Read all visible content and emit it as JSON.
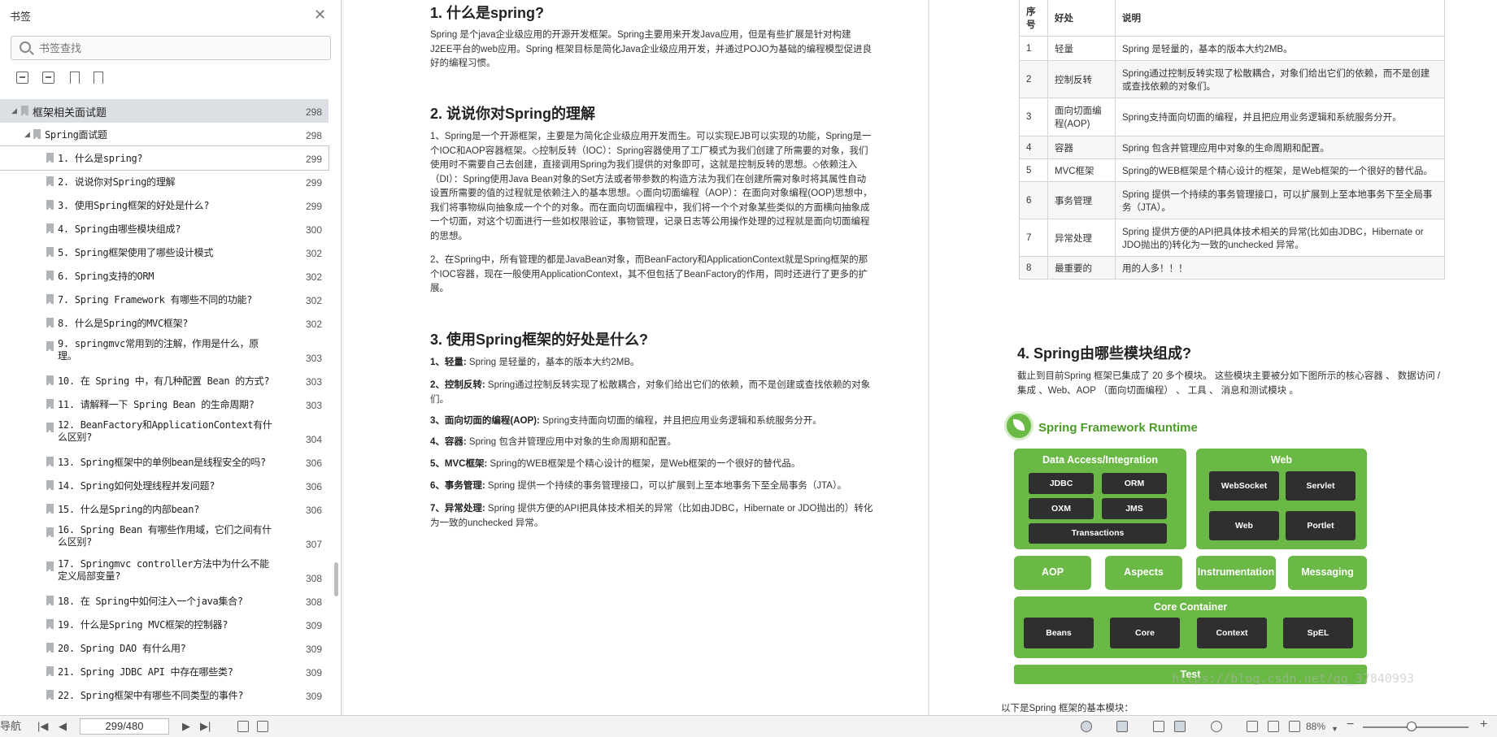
{
  "sidebar": {
    "title": "书签",
    "search_placeholder": "书签查找",
    "items": [
      {
        "label": "框架相关面试题",
        "page": "298"
      },
      {
        "label": "Spring面试题",
        "page": "298"
      },
      {
        "label": "1. 什么是spring?",
        "page": "299"
      },
      {
        "label": "2. 说说你对Spring的理解",
        "page": "299"
      },
      {
        "label": "3. 使用Spring框架的好处是什么?",
        "page": "299"
      },
      {
        "label": "4. Spring由哪些模块组成?",
        "page": "300"
      },
      {
        "label": "5. Spring框架使用了哪些设计模式",
        "page": "302"
      },
      {
        "label": "6. Spring支持的ORM",
        "page": "302"
      },
      {
        "label": "7. Spring Framework 有哪些不同的功能?",
        "page": "302"
      },
      {
        "label": "8. 什么是Spring的MVC框架?",
        "page": "302"
      },
      {
        "label": "9. springmvc常用到的注解，作用是什么，原理。",
        "page": "303"
      },
      {
        "label": "10. 在 Spring 中，有几种配置 Bean 的方式?",
        "page": "303"
      },
      {
        "label": "11. 请解释一下 Spring Bean 的生命周期?",
        "page": "303"
      },
      {
        "label": "12. BeanFactory和ApplicationContext有什么区别?",
        "page": "304"
      },
      {
        "label": "13. Spring框架中的单例bean是线程安全的吗?",
        "page": "306"
      },
      {
        "label": "14. Spring如何处理线程并发问题?",
        "page": "306"
      },
      {
        "label": "15. 什么是Spring的内部bean?",
        "page": "306"
      },
      {
        "label": "16. Spring Bean 有哪些作用域，它们之间有什么区别?",
        "page": "307"
      },
      {
        "label": "17. Springmvc controller方法中为什么不能定义局部变量?",
        "page": "308"
      },
      {
        "label": "18. 在 Spring中如何注入一个java集合?",
        "page": "308"
      },
      {
        "label": "19. 什么是Spring MVC框架的控制器?",
        "page": "309"
      },
      {
        "label": "20. Spring DAO 有什么用?",
        "page": "309"
      },
      {
        "label": "21. Spring JDBC API 中存在哪些类?",
        "page": "309"
      },
      {
        "label": "22. Spring框架中有哪些不同类型的事件?",
        "page": "309"
      }
    ]
  },
  "page1": {
    "s1": {
      "title": "1. 什么是spring?",
      "p1": "Spring 是个java企业级应用的开源开发框架。Spring主要用来开发Java应用，但是有些扩展是针对构建J2EE平台的web应用。Spring 框架目标是简化Java企业级应用开发，并通过POJO为基础的编程模型促进良好的编程习惯。"
    },
    "s2": {
      "title": "2. 说说你对Spring的理解",
      "p1": "1、Spring是一个开源框架，主要是为简化企业级应用开发而生。可以实现EJB可以实现的功能，Spring是一个IOC和AOP容器框架。◇控制反转（IOC）：Spring容器使用了工厂模式为我们创建了所需要的对象，我们使用时不需要自己去创建，直接调用Spring为我们提供的对象即可，这就是控制反转的思想。◇依赖注入（DI）：Spring使用Java Bean对象的Set方法或者带参数的构造方法为我们在创建所需对象时将其属性自动设置所需要的值的过程就是依赖注入的基本思想。◇面向切面编程（AOP）：在面向对象编程(OOP)思想中，我们将事物纵向抽象成一个个的对象。而在面向切面编程中，我们将一个个对象某些类似的方面横向抽象成一个切面，对这个切面进行一些如权限验证，事物管理，记录日志等公用操作处理的过程就是面向切面编程的思想。",
      "p2": "2、在Spring中，所有管理的都是JavaBean对象，而BeanFactory和ApplicationContext就是Spring框架的那个IOC容器，现在一般使用ApplicationContext，其不但包括了BeanFactory的作用，同时还进行了更多的扩展。"
    },
    "s3": {
      "title": "3. 使用Spring框架的好处是什么?",
      "items": [
        {
          "k": "1、轻量:",
          "v": " Spring 是轻量的，基本的版本大约2MB。"
        },
        {
          "k": "2、控制反转:",
          "v": " Spring通过控制反转实现了松散耦合，对象们给出它们的依赖，而不是创建或查找依赖的对象们。"
        },
        {
          "k": "3、面向切面的编程(AOP):",
          "v": " Spring支持面向切面的编程，并且把应用业务逻辑和系统服务分开。"
        },
        {
          "k": "4、容器:",
          "v": " Spring 包含并管理应用中对象的生命周期和配置。"
        },
        {
          "k": "5、MVC框架:",
          "v": " Spring的WEB框架是个精心设计的框架，是Web框架的一个很好的替代品。"
        },
        {
          "k": "6、事务管理:",
          "v": " Spring 提供一个持续的事务管理接口，可以扩展到上至本地事务下至全局事务（JTA）。"
        },
        {
          "k": "7、异常处理:",
          "v": " Spring 提供方便的API把具体技术相关的异常（比如由JDBC，Hibernate or JDO抛出的）转化为一致的unchecked 异常。"
        }
      ]
    }
  },
  "page2": {
    "table": {
      "headers": [
        "序号",
        "好处",
        "说明"
      ],
      "rows": [
        [
          "1",
          "轻量",
          "Spring 是轻量的，基本的版本大约2MB。"
        ],
        [
          "2",
          "控制反转",
          "Spring通过控制反转实现了松散耦合，对象们给出它们的依赖，而不是创建或查找依赖的对象们。"
        ],
        [
          "3",
          "面向切面编程(AOP)",
          "Spring支持面向切面的编程，并且把应用业务逻辑和系统服务分开。"
        ],
        [
          "4",
          "容器",
          "Spring 包含并管理应用中对象的生命周期和配置。"
        ],
        [
          "5",
          "MVC框架",
          "Spring的WEB框架是个精心设计的框架，是Web框架的一个很好的替代品。"
        ],
        [
          "6",
          "事务管理",
          "Spring 提供一个持续的事务管理接口，可以扩展到上至本地事务下至全局事务（JTA）。"
        ],
        [
          "7",
          "异常处理",
          "Spring 提供方便的API把具体技术相关的异常(比如由JDBC，Hibernate or JDO抛出的)转化为一致的unchecked 异常。"
        ],
        [
          "8",
          "最重要的",
          "用的人多！！！"
        ]
      ]
    },
    "s4": {
      "title": "4. Spring由哪些模块组成?",
      "p1": "截止到目前Spring 框架已集成了 20 多个模块。 这些模块主要被分如下图所示的核心容器 、 数据访问 / 集成 、Web、AOP （面向切面编程） 、 工具 、 消息和测试模块 。",
      "note": "以下是Spring 框架的基本模块："
    },
    "diagram": {
      "title": "Spring Framework Runtime",
      "data_access": "Data Access/Integration",
      "web": "Web",
      "jdbc": "JDBC",
      "orm": "ORM",
      "oxm": "OXM",
      "jms": "JMS",
      "transactions": "Transactions",
      "websocket": "WebSocket",
      "servlet": "Servlet",
      "webmod": "Web",
      "portlet": "Portlet",
      "aop": "AOP",
      "aspects": "Aspects",
      "instrumentation": "Instrumentation",
      "messaging": "Messaging",
      "core_container": "Core Container",
      "beans": "Beans",
      "core": "Core",
      "context": "Context",
      "spel": "SpEL",
      "test": "Test",
      "watermark": "https://blog.csdn.net/qq_37840993"
    }
  },
  "bottombar": {
    "left_label": "导航",
    "page_indicator": "299/480",
    "zoom": "88%"
  }
}
